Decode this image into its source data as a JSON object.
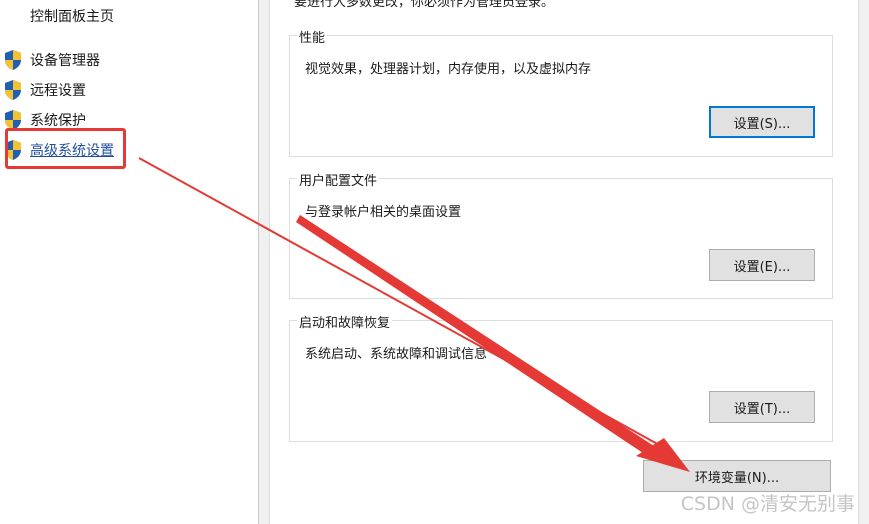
{
  "left_nav": {
    "control_panel_home": "控制面板主页",
    "items": [
      {
        "label": "设备管理器",
        "icon": "uac-shield-icon"
      },
      {
        "label": "远程设置",
        "icon": "uac-shield-icon"
      },
      {
        "label": "系统保护",
        "icon": "uac-shield-icon"
      },
      {
        "label": "高级系统设置",
        "icon": "uac-shield-icon",
        "active": true
      }
    ]
  },
  "dialog": {
    "admin_note": "要进行大多数更改，你必须作为管理员登录。",
    "performance": {
      "title": "性能",
      "description": "视觉效果，处理器计划，内存使用，以及虚拟内存",
      "button": "设置(S)..."
    },
    "user_profiles": {
      "title": "用户配置文件",
      "description": "与登录帐户相关的桌面设置",
      "button": "设置(E)..."
    },
    "startup_recovery": {
      "title": "启动和故障恢复",
      "description": "系统启动、系统故障和调试信息",
      "button": "设置(T)..."
    },
    "env_button": "环境变量(N)..."
  },
  "annotation": {
    "color": "#e53935"
  },
  "watermark": "CSDN @清安无别事"
}
